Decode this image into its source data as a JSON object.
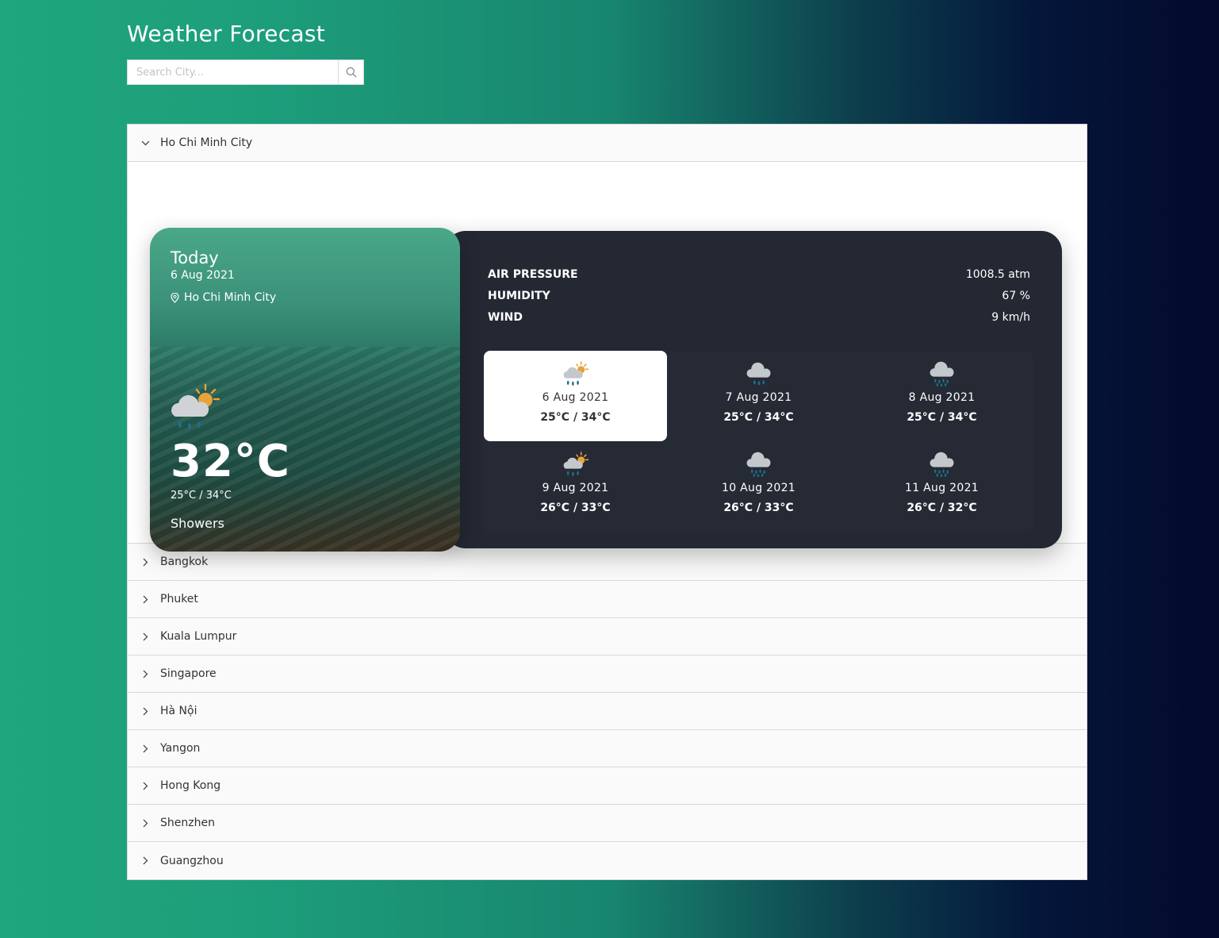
{
  "header": {
    "title": "Weather Forecast",
    "search_placeholder": "Search City..."
  },
  "expanded_city": {
    "name": "Ho Chi Minh City",
    "today": {
      "label": "Today",
      "date": "6 Aug 2021",
      "location": "Ho Chi Minh City",
      "temperature": "32°C",
      "range": "25°C / 34°C",
      "condition": "Showers",
      "icon": "sun-cloud-rain-icon"
    },
    "stats": [
      {
        "label": "AIR PRESSURE",
        "value": "1008.5 atm"
      },
      {
        "label": "HUMIDITY",
        "value": "67 %"
      },
      {
        "label": "WIND",
        "value": "9 km/h"
      }
    ],
    "forecast": [
      {
        "date": "6 Aug 2021",
        "range": "25°C / 34°C",
        "icon": "sun-cloud-rain-icon",
        "selected": true
      },
      {
        "date": "7 Aug 2021",
        "range": "25°C / 34°C",
        "icon": "cloud-rain-icon",
        "selected": false
      },
      {
        "date": "8 Aug 2021",
        "range": "25°C / 34°C",
        "icon": "cloud-heavy-rain-icon",
        "selected": false
      },
      {
        "date": "9 Aug 2021",
        "range": "26°C / 33°C",
        "icon": "sun-cloud-rain-icon",
        "selected": false
      },
      {
        "date": "10 Aug 2021",
        "range": "26°C / 33°C",
        "icon": "cloud-heavy-rain-icon",
        "selected": false
      },
      {
        "date": "11 Aug 2021",
        "range": "26°C / 32°C",
        "icon": "cloud-heavy-rain-icon",
        "selected": false
      }
    ]
  },
  "cities": [
    "Bangkok",
    "Phuket",
    "Kuala Lumpur",
    "Singapore",
    "Hà Nội",
    "Yangon",
    "Hong Kong",
    "Shenzhen",
    "Guangzhou"
  ],
  "colors": {
    "accent_green": "#1fa67c",
    "dark_navy": "#030a2c",
    "card_dark": "#232833",
    "sun_orange": "#e8a33b",
    "rain_blue": "#1f6f8b"
  }
}
